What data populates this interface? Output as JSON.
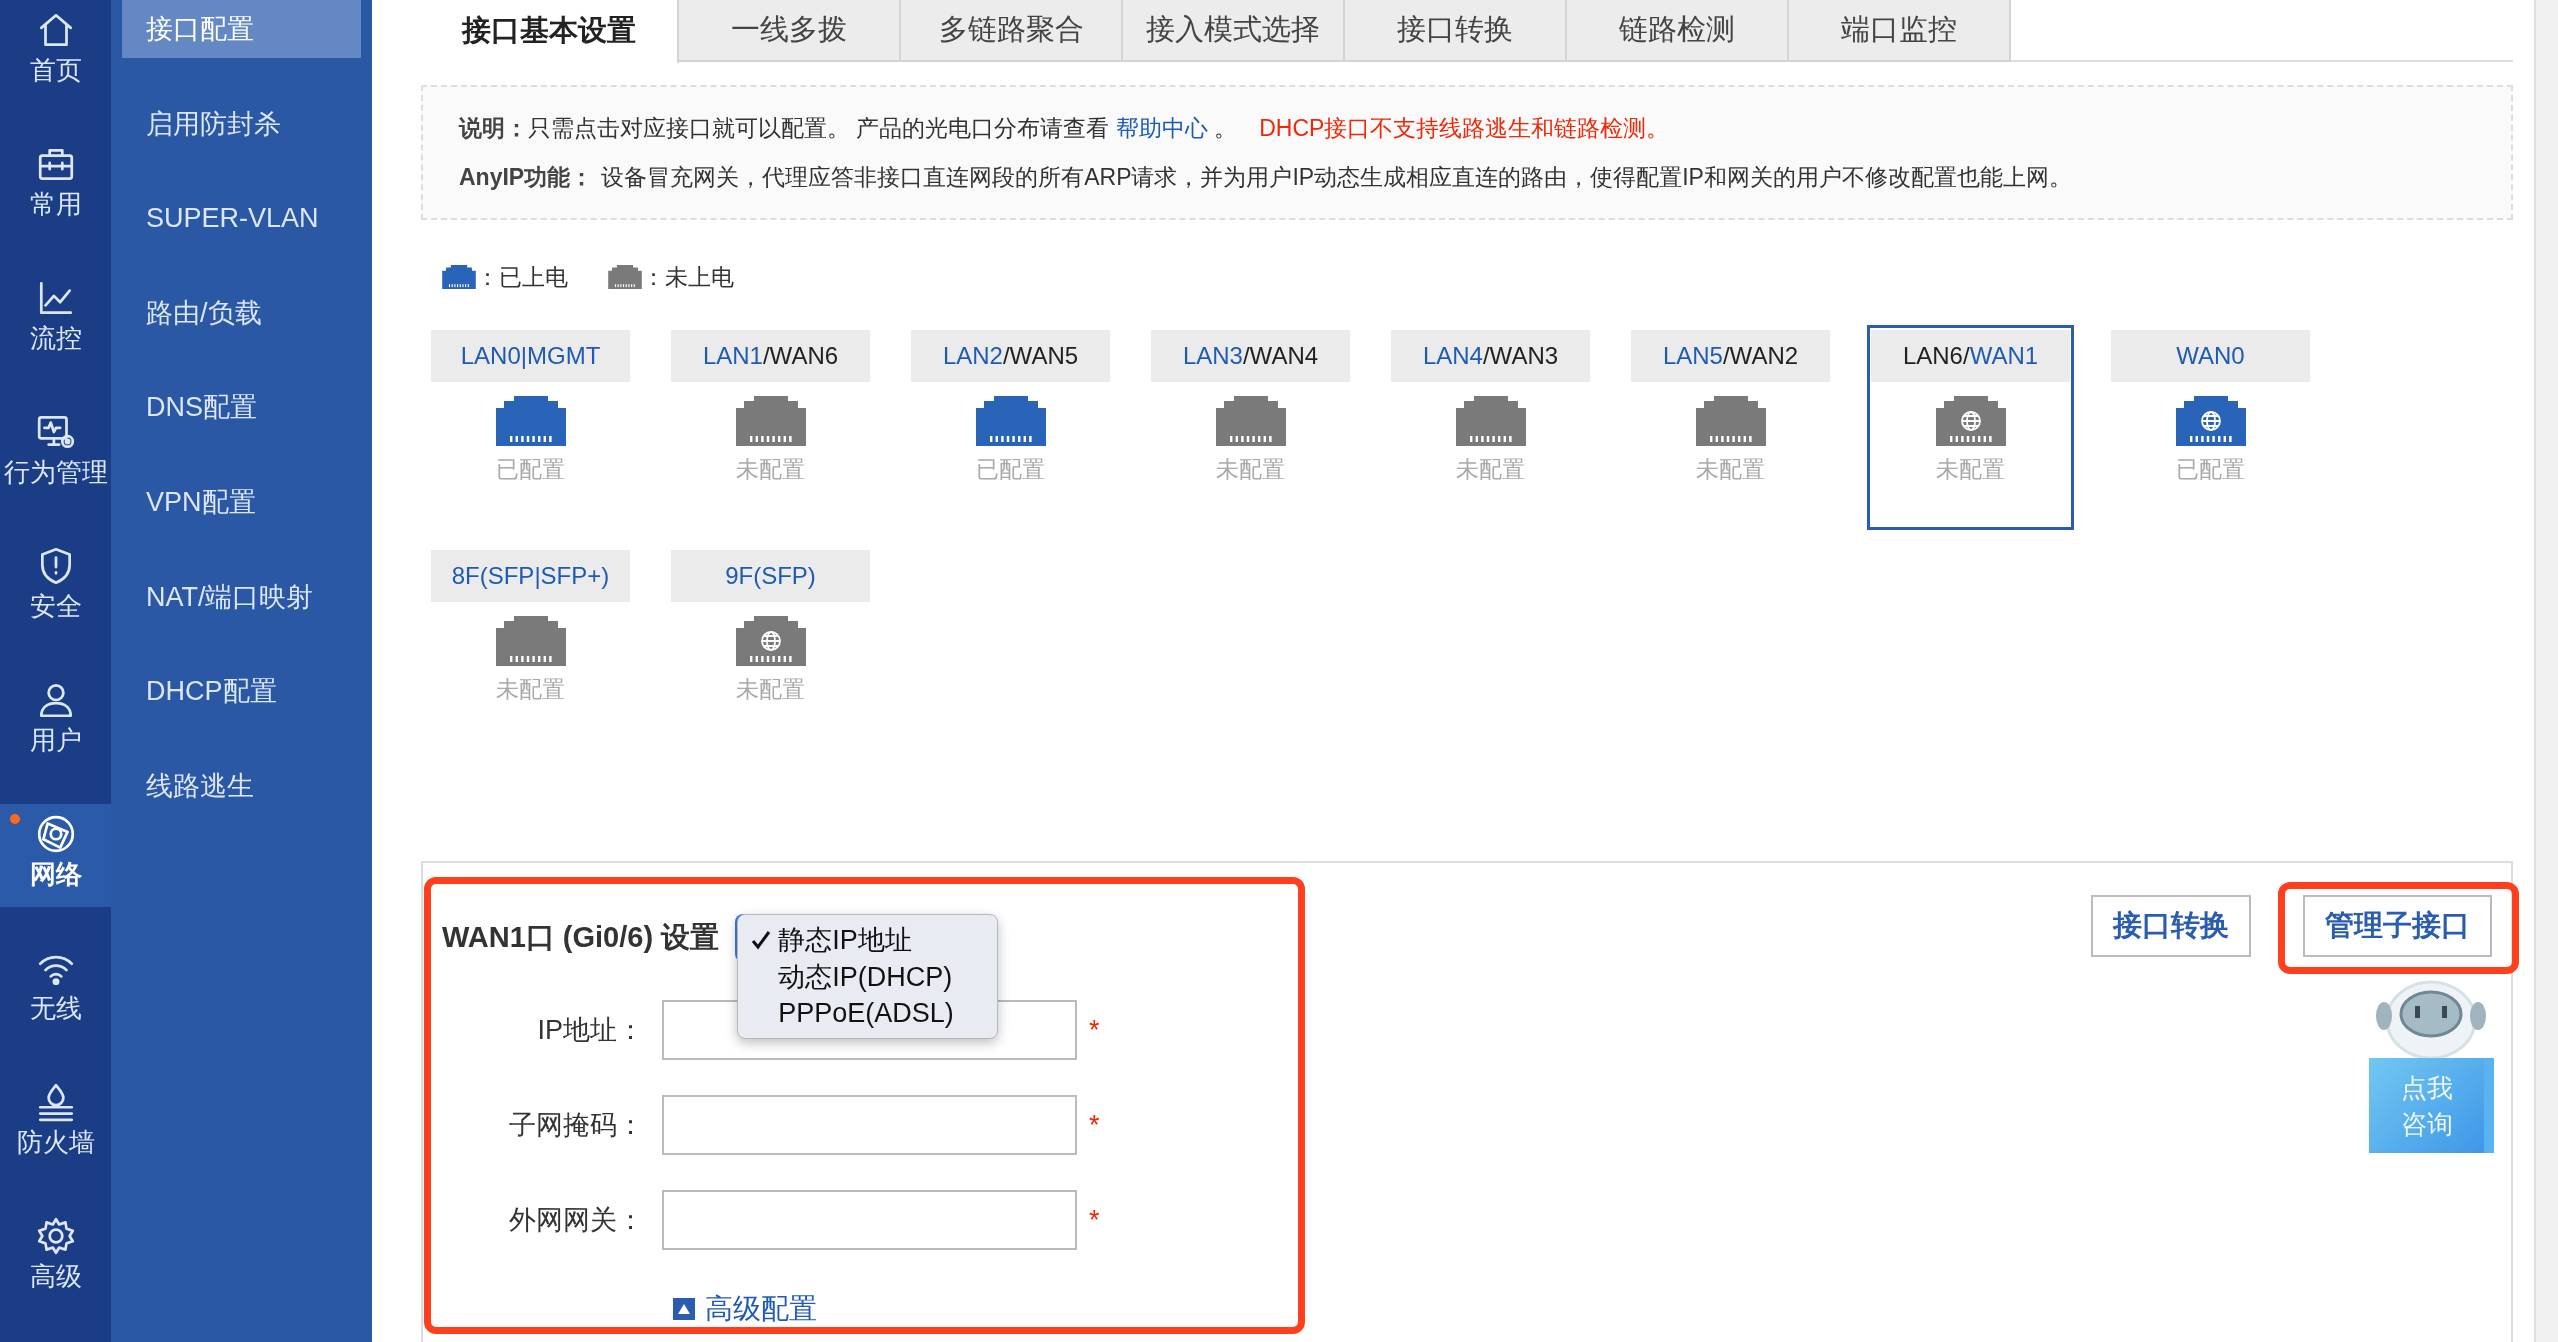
{
  "rail": [
    {
      "label": "首页",
      "kind": "home",
      "selected": false,
      "notice": false
    },
    {
      "label": "常用",
      "kind": "briefcase",
      "selected": false,
      "notice": false
    },
    {
      "label": "流控",
      "kind": "chart",
      "selected": false,
      "notice": false
    },
    {
      "label": "行为管理",
      "kind": "monitor",
      "selected": false,
      "notice": false
    },
    {
      "label": "安全",
      "kind": "shield",
      "selected": false,
      "notice": false
    },
    {
      "label": "用户",
      "kind": "user",
      "selected": false,
      "notice": false
    },
    {
      "label": "网络",
      "kind": "network",
      "selected": true,
      "notice": true
    },
    {
      "label": "无线",
      "kind": "wifi",
      "selected": false,
      "notice": false
    },
    {
      "label": "防火墙",
      "kind": "firewall",
      "selected": false,
      "notice": false
    },
    {
      "label": "高级",
      "kind": "gear",
      "selected": false,
      "notice": false
    }
  ],
  "submenu": [
    {
      "label": "接口配置",
      "selected": true
    },
    {
      "label": "启用防封杀",
      "selected": false
    },
    {
      "label": "SUPER-VLAN",
      "selected": false
    },
    {
      "label": "路由/负载",
      "selected": false
    },
    {
      "label": "DNS配置",
      "selected": false
    },
    {
      "label": "VPN配置",
      "selected": false
    },
    {
      "label": "NAT/端口映射",
      "selected": false
    },
    {
      "label": "DHCP配置",
      "selected": false
    },
    {
      "label": "线路逃生",
      "selected": false
    }
  ],
  "tabs": [
    {
      "label": "接口基本设置",
      "selected": true
    },
    {
      "label": "一线多拨",
      "selected": false
    },
    {
      "label": "多链路聚合",
      "selected": false
    },
    {
      "label": "接入模式选择",
      "selected": false
    },
    {
      "label": "接口转换",
      "selected": false
    },
    {
      "label": "链路检测",
      "selected": false
    },
    {
      "label": "端口监控",
      "selected": false
    }
  ],
  "notes": {
    "notice_label": "说明：",
    "notice_text": "只需点击对应接口就可以配置。 产品的光电口分布请查看 ",
    "help_link": "帮助中心",
    "notice_tail": " 。",
    "warning": "DHCP接口不支持线路逃生和链路检测。",
    "anyip_label": "AnyIP功能：",
    "anyip_text": "设备冒充网关，代理应答非接口直连网段的所有ARP请求，并为用户IP动态生成相应直连的路由，使得配置IP和网关的用户不修改配置也能上网。"
  },
  "legend": [
    {
      "label": "：已上电",
      "powered": true
    },
    {
      "label": "：未上电",
      "powered": false
    }
  ],
  "ports": [
    {
      "parts": [
        {
          "text": "LAN0|MGMT",
          "active": true
        }
      ],
      "kind": "plain",
      "powered": true,
      "status": "已配置",
      "selected": false
    },
    {
      "parts": [
        {
          "text": "LAN1",
          "active": true
        },
        {
          "text": "/WAN6",
          "active": false
        }
      ],
      "kind": "plain",
      "powered": false,
      "status": "未配置",
      "selected": false
    },
    {
      "parts": [
        {
          "text": "LAN2",
          "active": true
        },
        {
          "text": "/WAN5",
          "active": false
        }
      ],
      "kind": "plain",
      "powered": true,
      "status": "已配置",
      "selected": false
    },
    {
      "parts": [
        {
          "text": "LAN3",
          "active": true
        },
        {
          "text": "/WAN4",
          "active": false
        }
      ],
      "kind": "plain",
      "powered": false,
      "status": "未配置",
      "selected": false
    },
    {
      "parts": [
        {
          "text": "LAN4",
          "active": true
        },
        {
          "text": "/WAN3",
          "active": false
        }
      ],
      "kind": "plain",
      "powered": false,
      "status": "未配置",
      "selected": false
    },
    {
      "parts": [
        {
          "text": "LAN5",
          "active": true
        },
        {
          "text": "/WAN2",
          "active": false
        }
      ],
      "kind": "plain",
      "powered": false,
      "status": "未配置",
      "selected": false
    },
    {
      "parts": [
        {
          "text": "LAN6/",
          "active": false
        },
        {
          "text": "WAN1",
          "active": true
        }
      ],
      "kind": "globe",
      "powered": false,
      "status": "未配置",
      "selected": true
    },
    {
      "parts": [
        {
          "text": "WAN0",
          "active": true
        }
      ],
      "kind": "globe",
      "powered": true,
      "status": "已配置",
      "selected": false
    },
    {
      "parts": [
        {
          "text": "8F(SFP|SFP+)",
          "active": true
        }
      ],
      "kind": "plain",
      "powered": false,
      "status": "未配置",
      "selected": false
    },
    {
      "parts": [
        {
          "text": "9F(SFP)",
          "active": true
        }
      ],
      "kind": "globe",
      "powered": false,
      "status": "未配置",
      "selected": false
    }
  ],
  "wan_panel": {
    "title": "WAN1口 (Gi0/6) 设置",
    "highlighted": true,
    "mode_menu": [
      {
        "label": "静态IP地址",
        "selected": true
      },
      {
        "label": "动态IP(DHCP)",
        "selected": false
      },
      {
        "label": "PPPoE(ADSL)",
        "selected": false
      }
    ],
    "fields": [
      {
        "label": "IP地址：",
        "required_mark": "*"
      },
      {
        "label": "子网掩码：",
        "required_mark": "*"
      },
      {
        "label": "外网网关：",
        "required_mark": "*"
      }
    ],
    "advanced": "高级配置",
    "actions": [
      {
        "label": "接口转换",
        "highlighted": false
      },
      {
        "label": "管理子接口",
        "highlighted": true
      }
    ],
    "consult": "点我咨询"
  }
}
